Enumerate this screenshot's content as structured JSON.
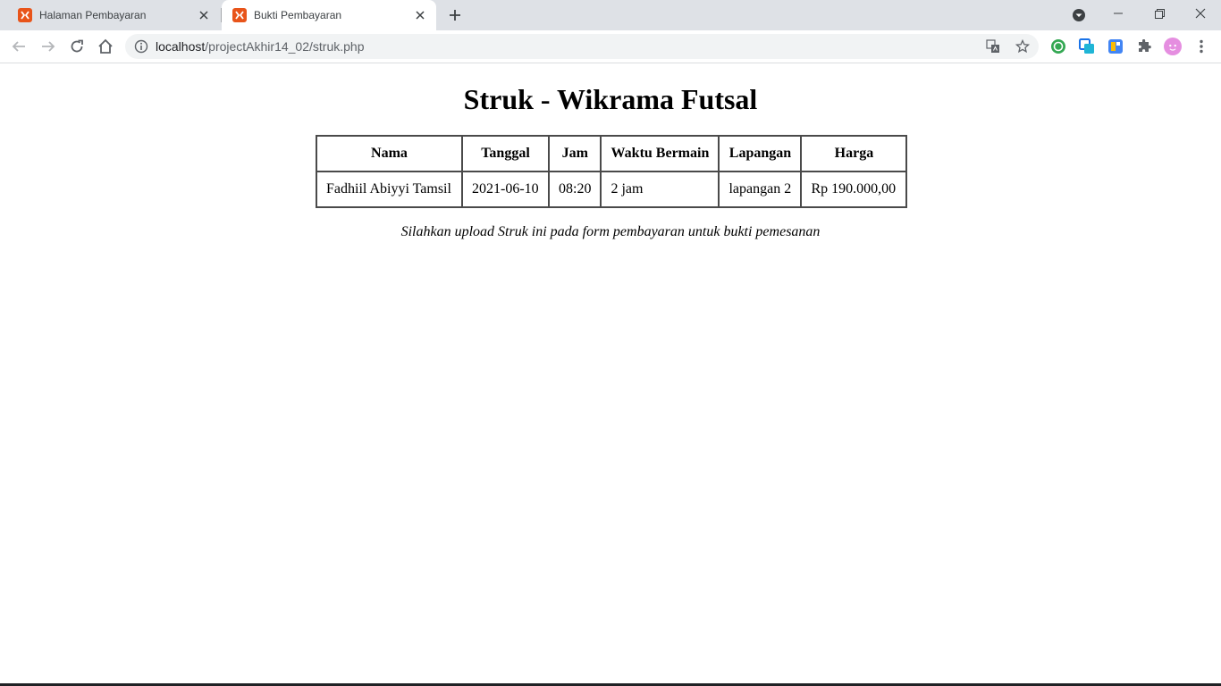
{
  "browser": {
    "tabs": [
      {
        "title": "Halaman Pembayaran",
        "active": false
      },
      {
        "title": "Bukti Pembayaran",
        "active": true
      }
    ],
    "url_host": "localhost",
    "url_path": "/projectAkhir14_02/struk.php",
    "colors": {
      "tabstrip": "#dee1e6",
      "favicon": "#e8541a",
      "profile": "#e58ee0"
    }
  },
  "page": {
    "title": "Struk - Wikrama Futsal",
    "table": {
      "headers": [
        "Nama",
        "Tanggal",
        "Jam",
        "Waktu Bermain",
        "Lapangan",
        "Harga"
      ],
      "rows": [
        [
          "Fadhiil Abiyyi Tamsil",
          "2021-06-10",
          "08:20",
          "2 jam",
          "lapangan 2",
          "Rp 190.000,00"
        ]
      ]
    },
    "note": "Silahkan upload Struk ini pada form pembayaran untuk bukti pemesanan"
  }
}
